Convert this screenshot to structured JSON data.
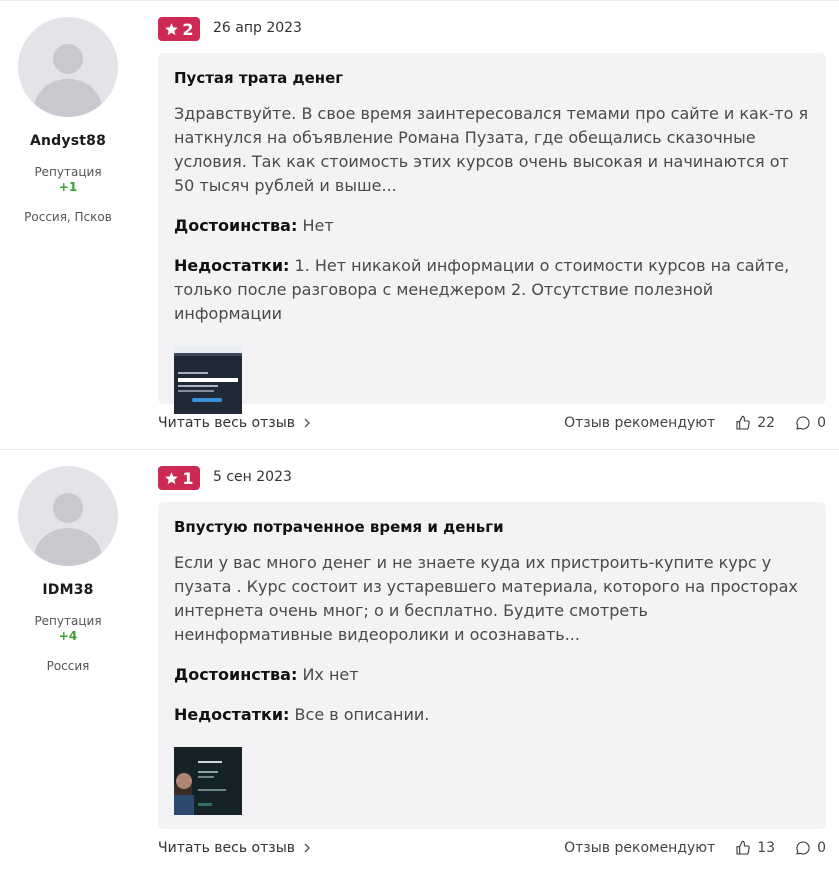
{
  "reviews": [
    {
      "rating": "2",
      "date": "26 апр 2023",
      "author": {
        "name": "Andyst88",
        "reputation_label": "Репутация",
        "reputation_value": "+1",
        "location": "Россия, Псков"
      },
      "title": "Пустая трата денег",
      "text": "Здравствуйте. В свое время заинтересовался темами про сайте и как-то я наткнулся на объявление Романа Пузата, где обещались сказочные условия. Так как стоимость этих курсов очень высокая и начинаются от 50 тысяч рублей и выше...",
      "pros_label": "Достоинства:",
      "pros": "Нет",
      "cons_label": "Недостатки:",
      "cons": "1. Нет никакой информации о стоимости курсов на сайте, только после разговора с менеджером 2. Отсутствие полезной информации",
      "read_more": "Читать весь отзыв",
      "recommend_label": "Отзыв рекомендуют",
      "likes": "22",
      "comments": "0",
      "thumbnail_icon": "screenshot-thumbnail"
    },
    {
      "rating": "1",
      "date": "5 сен 2023",
      "author": {
        "name": "IDM38",
        "reputation_label": "Репутация",
        "reputation_value": "+4",
        "location": "Россия"
      },
      "title": "Впустую потраченное время и деньги",
      "text": "Если у вас много денег и не знаете куда их пристроить-купите курс у пузата . Курс состоит из устаревшего материала, которого на просторах интернета очень мног; о и бесплатно. Будите смотреть неинформативные видеоролики и осознавать...",
      "pros_label": "Достоинства:",
      "pros": "Их нет",
      "cons_label": "Недостатки:",
      "cons": "Все в описании.",
      "read_more": "Читать весь отзыв",
      "recommend_label": "Отзыв рекомендуют",
      "likes": "13",
      "comments": "0",
      "thumbnail_icon": "screenshot-thumbnail"
    }
  ],
  "colors": {
    "badge": "#cc2a52",
    "reputation": "#3aa036",
    "card_bg": "#f3f3f5"
  }
}
